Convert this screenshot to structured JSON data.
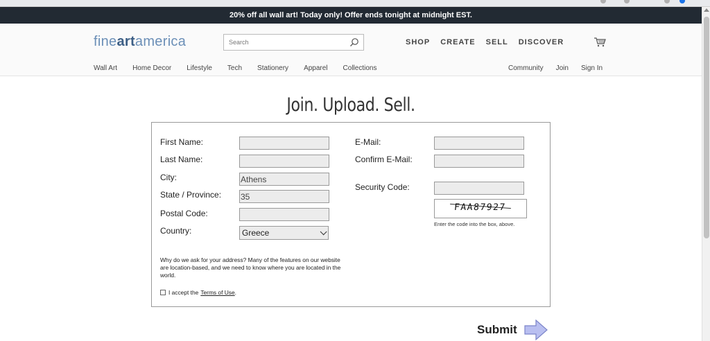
{
  "promo": {
    "text": "20% off all wall art!   Today only!   Offer ends tonight at midnight EST."
  },
  "header": {
    "logo": {
      "part1": "fine",
      "part2": "art",
      "part3": "america"
    },
    "search": {
      "placeholder": "Search",
      "icon": "search-icon"
    },
    "main_nav": [
      "SHOP",
      "CREATE",
      "SELL",
      "DISCOVER"
    ],
    "cart_icon": "cart-icon",
    "sub_nav": [
      "Wall Art",
      "Home Decor",
      "Lifestyle",
      "Tech",
      "Stationery",
      "Apparel",
      "Collections"
    ],
    "sub_nav_right": [
      "Community",
      "Join",
      "Sign In"
    ]
  },
  "page_title": "Join. Upload. Sell.",
  "form": {
    "left": {
      "first_name": {
        "label": "First Name:",
        "value": ""
      },
      "last_name": {
        "label": "Last Name:",
        "value": ""
      },
      "city": {
        "label": "City:",
        "value": "Athens"
      },
      "state": {
        "label": "State / Province:",
        "value": "35"
      },
      "postal": {
        "label": "Postal Code:",
        "value": ""
      },
      "country": {
        "label": "Country:",
        "value": "Greece"
      }
    },
    "right": {
      "email": {
        "label": "E-Mail:",
        "value": ""
      },
      "confirm_email": {
        "label": "Confirm E-Mail:",
        "value": ""
      },
      "security_code": {
        "label": "Security Code:",
        "value": ""
      }
    },
    "captcha": {
      "text": "FAA87927",
      "hint": "Enter the code into the box, above."
    },
    "why_text": "Why do we ask for your address?   Many of the features on our website are location-based, and we need to know where you are located in the world.",
    "terms": {
      "prefix": "I accept the",
      "link": "Terms of Use",
      "suffix": "."
    }
  },
  "submit": {
    "label": "Submit"
  },
  "colors": {
    "promo_bg": "#222a33",
    "logo": "#6b8fb7",
    "arrow": "#b9bff0"
  }
}
